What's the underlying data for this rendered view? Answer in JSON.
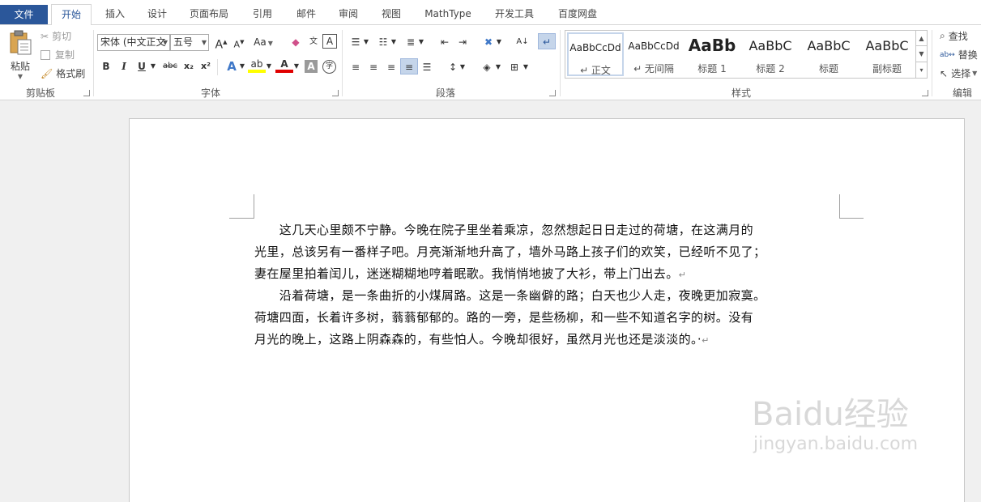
{
  "tabs": [
    "文件",
    "开始",
    "插入",
    "设计",
    "页面布局",
    "引用",
    "邮件",
    "审阅",
    "视图",
    "MathType",
    "开发工具",
    "百度网盘"
  ],
  "clipboard": {
    "paste_label": "粘贴",
    "cut_label": "剪切",
    "copy_label": "复制",
    "format_painter_label": "格式刷",
    "group_label": "剪贴板"
  },
  "font": {
    "font_name": "宋体 (中文正文",
    "font_size": "五号",
    "group_label": "字体",
    "grow_label": "A",
    "shrink_label": "A",
    "case_label": "Aa",
    "bold": "B",
    "italic": "I",
    "underline": "U",
    "strike": "abc",
    "subscript": "x₂",
    "superscript": "x²"
  },
  "paragraph": {
    "group_label": "段落"
  },
  "styles": {
    "group_label": "样式",
    "items": [
      {
        "sample": "AaBbCcDd",
        "name": "↵ 正文"
      },
      {
        "sample": "AaBbCcDd",
        "name": "↵ 无间隔"
      },
      {
        "sample": "AaBb",
        "name": "标题 1"
      },
      {
        "sample": "AaBbC",
        "name": "标题 2"
      },
      {
        "sample": "AaBbC",
        "name": "标题"
      },
      {
        "sample": "AaBbC",
        "name": "副标题"
      }
    ]
  },
  "editing": {
    "group_label": "编辑",
    "find_label": "查找",
    "replace_label": "替换",
    "select_label": "选择"
  },
  "document": {
    "paragraphs": [
      {
        "lines": [
          "　　这几天心里颇不宁静。今晚在院子里坐着乘凉，忽然想起日日走过的荷塘，在这满月的",
          "光里，总该另有一番样子吧。月亮渐渐地升高了，墙外马路上孩子们的欢笑，已经听不见了；",
          "妻在屋里拍着闰儿，迷迷糊糊地哼着眠歌。我悄悄地披了大衫，带上门出去。"
        ]
      },
      {
        "lines": [
          "　　沿着荷塘，是一条曲折的小煤屑路。这是一条幽僻的路；白天也少人走，夜晚更加寂寞。",
          "荷塘四面，长着许多树，蓊蓊郁郁的。路的一旁，是些杨柳，和一些不知道名字的树。没有",
          "月光的晚上，这路上阴森森的，有些怕人。今晚却很好，虽然月光也还是淡淡的。·"
        ]
      }
    ],
    "para_mark": "↵"
  },
  "watermark": {
    "brand": "Baidu经验",
    "url": "jingyan.baidu.com"
  },
  "colors": {
    "file_tab": "#2b579a",
    "accent": "#2b579a",
    "highlight": "#ffff00",
    "font_color": "#e00000"
  }
}
